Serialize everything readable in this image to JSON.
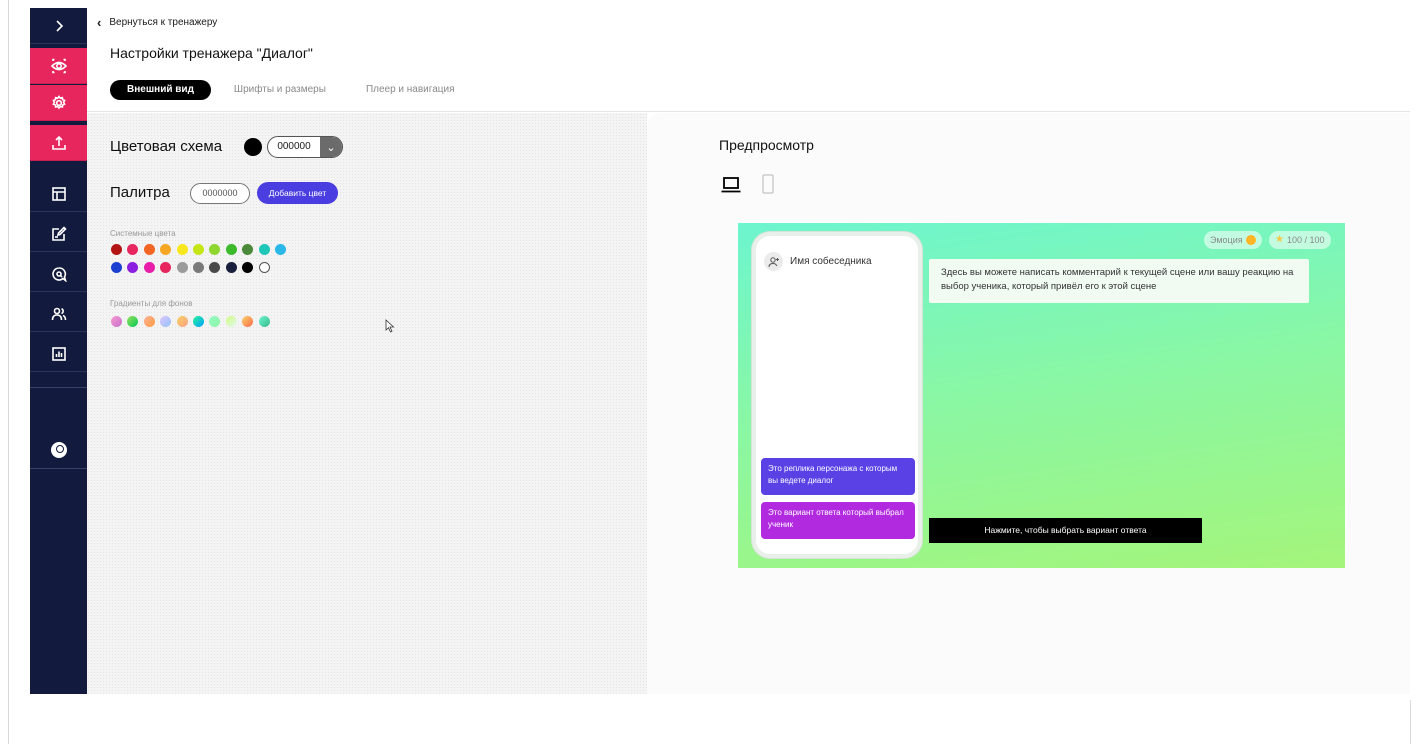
{
  "header": {
    "back_label": "Вернуться к тренажеру",
    "title": "Настройки тренажера \"Диалог\"",
    "tabs": [
      {
        "label": "Внешний вид",
        "active": true
      },
      {
        "label": "Шрифты и размеры",
        "active": false
      },
      {
        "label": "Плеер и навигация",
        "active": false
      }
    ]
  },
  "sidebar": {
    "accent": "#e8265e",
    "background": "#121a3d",
    "items": [
      {
        "icon": "chevron-right-icon"
      },
      {
        "icon": "eye-icon"
      },
      {
        "icon": "gear-icon"
      },
      {
        "icon": "upload-icon"
      },
      {
        "icon": "layout-icon"
      },
      {
        "icon": "edit-icon"
      },
      {
        "icon": "chat-search-icon"
      },
      {
        "icon": "users-icon"
      },
      {
        "icon": "chart-icon"
      },
      {
        "icon": "user-avatar-icon"
      }
    ]
  },
  "settings": {
    "color_scheme_label": "Цветовая схема",
    "color_scheme_value": "000000",
    "palette_label": "Палитра",
    "palette_input_value": "0000000",
    "add_color_label": "Добавить цвет",
    "system_colors_label": "Системные цвета",
    "system_colors_row1": [
      "#b31414",
      "#e8265e",
      "#f26522",
      "#f5a623",
      "#f8e71c",
      "#c6e516",
      "#8fd62e",
      "#3cba2c",
      "#4a8a3a",
      "#1ec7b7",
      "#2ab8e8"
    ],
    "system_colors_row2": [
      "#1a3fd1",
      "#8b1ee0",
      "#e81ea8",
      "#e8265e",
      "#9b9b9b",
      "#7a7a7a",
      "#4a4a4a",
      "#1a1f3d",
      "#000000",
      "#ffffff"
    ],
    "gradients_label": "Градиенты для фонов",
    "gradients": [
      [
        "#f79ad3",
        "#c86fc9"
      ],
      [
        "#9be15d",
        "#00c853"
      ],
      [
        "#ffb199",
        "#ff9a3c"
      ],
      [
        "#e0c3fc",
        "#8ec5fc"
      ],
      [
        "#f6d365",
        "#fda085"
      ],
      [
        "#2af598",
        "#009efd"
      ],
      [
        "#96fbc4",
        "#8cf5a6"
      ],
      [
        "#d4fc79",
        "#e0f7fa"
      ],
      [
        "#f6d365",
        "#ff6a4d"
      ],
      [
        "#6df5cf",
        "#39b98a"
      ]
    ]
  },
  "preview": {
    "title": "Предпросмотр",
    "emotion_label": "Эмоция",
    "score_label": "100 / 100",
    "interlocutor_name": "Имя собеседника",
    "comment_text": "Здесь вы можете написать комментарий к текущей сцене или вашу реакцию на выбор ученика, который привёл его к этой сцене",
    "character_reply": "Это реплика персонажа с которым вы ведете диалог",
    "student_answer": "Это вариант ответа который выбрал ученик",
    "choose_button": "Нажмите, чтобы выбрать вариант ответа"
  }
}
